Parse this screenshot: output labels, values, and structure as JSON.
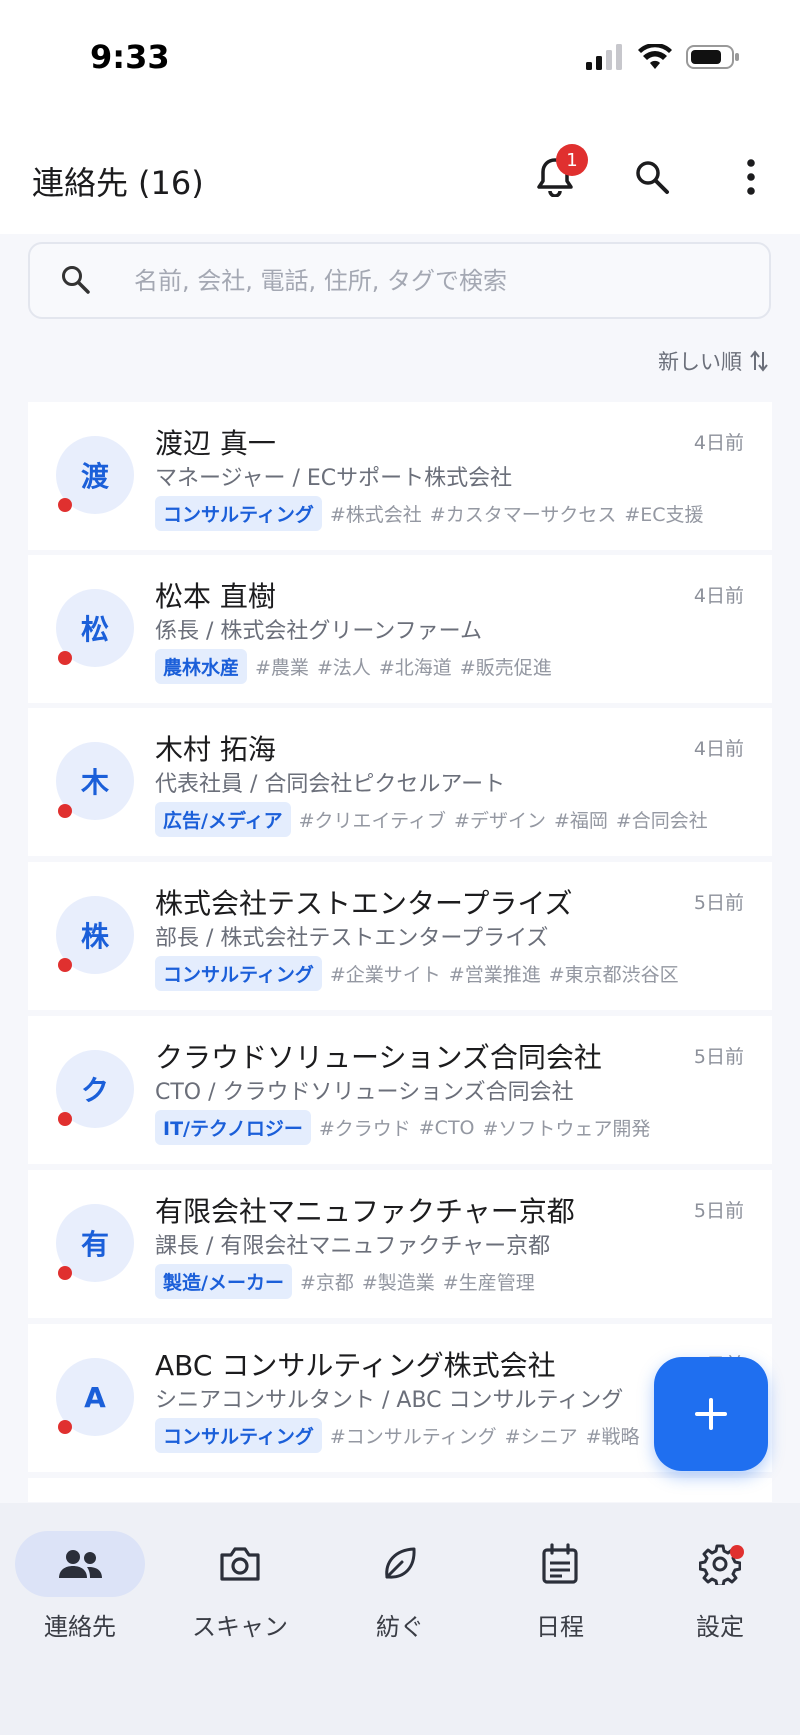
{
  "status_bar": {
    "time": "9:33"
  },
  "header": {
    "title": "連絡先",
    "count": "(16)",
    "notification_count": "1"
  },
  "search": {
    "placeholder": "名前, 会社, 電話, 住所, タグで検索"
  },
  "sort": {
    "label": "新しい順"
  },
  "contacts": [
    {
      "initial": "渡",
      "name": "渡辺 真一",
      "role": "マネージャー / ECサポート株式会社",
      "when": "4日前",
      "category": "コンサルティング",
      "tags": [
        "#株式会社",
        "#カスタマーサクセス",
        "#EC支援"
      ]
    },
    {
      "initial": "松",
      "name": "松本 直樹",
      "role": "係長 / 株式会社グリーンファーム",
      "when": "4日前",
      "category": "農林水産",
      "tags": [
        "#農業",
        "#法人",
        "#北海道",
        "#販売促進"
      ]
    },
    {
      "initial": "木",
      "name": "木村 拓海",
      "role": "代表社員 / 合同会社ピクセルアート",
      "when": "4日前",
      "category": "広告/メディア",
      "tags": [
        "#クリエイティブ",
        "#デザイン",
        "#福岡",
        "#合同会社"
      ]
    },
    {
      "initial": "株",
      "name": "株式会社テストエンタープライズ",
      "role": "部長 / 株式会社テストエンタープライズ",
      "when": "5日前",
      "category": "コンサルティング",
      "tags": [
        "#企業サイト",
        "#営業推進",
        "#東京都渋谷区"
      ]
    },
    {
      "initial": "ク",
      "name": "クラウドソリューションズ合同会社",
      "role": "CTO / クラウドソリューションズ合同会社",
      "when": "5日前",
      "category": "IT/テクノロジー",
      "tags": [
        "#クラウド",
        "#CTO",
        "#ソフトウェア開発"
      ]
    },
    {
      "initial": "有",
      "name": "有限会社マニュファクチャー京都",
      "role": "課長 / 有限会社マニュファクチャー京都",
      "when": "5日前",
      "category": "製造/メーカー",
      "tags": [
        "#京都",
        "#製造業",
        "#生産管理"
      ]
    },
    {
      "initial": "A",
      "name": "ABC コンサルティング株式会社",
      "role": "シニアコンサルタント / ABC コンサルティング",
      "when": "5日前",
      "category": "コンサルティング",
      "tags": [
        "#コンサルティング",
        "#シニア",
        "#戦略"
      ]
    }
  ],
  "tabs": [
    {
      "label": "連絡先",
      "icon": "people-icon"
    },
    {
      "label": "スキャン",
      "icon": "camera-icon"
    },
    {
      "label": "紡ぐ",
      "icon": "leaf-icon"
    },
    {
      "label": "日程",
      "icon": "calendar-icon"
    },
    {
      "label": "設定",
      "icon": "gear-icon"
    }
  ],
  "colors": {
    "accent": "#1f6ff0",
    "badge": "#e0302f",
    "tag_bg": "#e4edfd",
    "tag_text": "#1b5fd9"
  }
}
